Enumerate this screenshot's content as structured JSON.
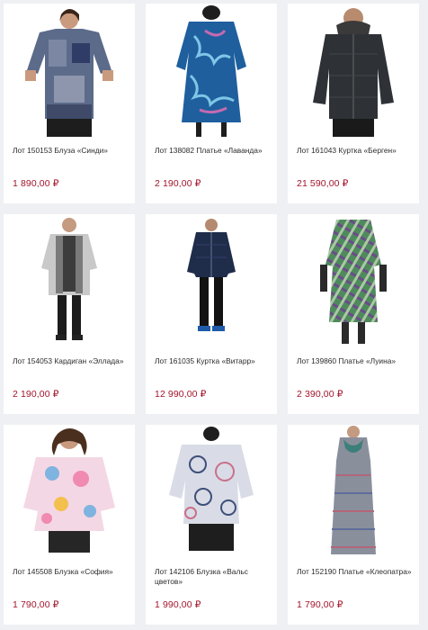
{
  "products": [
    {
      "title": "Лот 150153 Блуза «Синди»",
      "price": "1 890,00 ₽",
      "icon": "blouse-photo"
    },
    {
      "title": "Лот 138082 Платье «Лаванда»",
      "price": "2 190,00 ₽",
      "icon": "dress-photo"
    },
    {
      "title": "Лот 161043 Куртка «Берген»",
      "price": "21 590,00 ₽",
      "icon": "jacket-photo"
    },
    {
      "title": "Лот 154053 Кардиган «Эллада»",
      "price": "2 190,00 ₽",
      "icon": "cardigan-photo"
    },
    {
      "title": "Лот 161035 Куртка «Витарр»",
      "price": "12 990,00 ₽",
      "icon": "jacket-photo"
    },
    {
      "title": "Лот 139860 Платье «Луина»",
      "price": "2 390,00 ₽",
      "icon": "dress-photo"
    },
    {
      "title": "Лот 145508 Блузка «София»",
      "price": "1 790,00 ₽",
      "icon": "blouse-photo"
    },
    {
      "title": "Лот 142106 Блузка «Вальс цветов»",
      "price": "1 990,00 ₽",
      "icon": "blouse-photo"
    },
    {
      "title": "Лот 152190 Платье «Клеопатра»",
      "price": "1 790,00 ₽",
      "icon": "dress-photo"
    }
  ],
  "colors": {
    "price": "#a3142b",
    "card": "#ffffff",
    "background": "#eef0f3"
  }
}
